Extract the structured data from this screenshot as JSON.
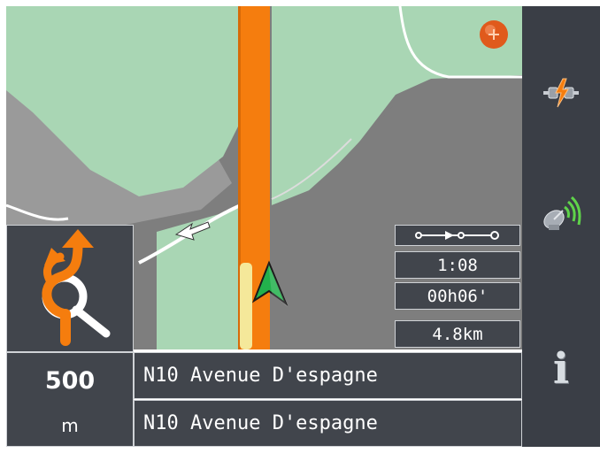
{
  "map": {
    "colors": {
      "land_green": "#a9d6b4",
      "land_gray": "#9b9b9b",
      "background": "#7e7e7e",
      "route": "#f57d0e",
      "position_arrow": "#22b14c"
    }
  },
  "route_info": {
    "legend_icon": "route-progress-icon",
    "arrival_time": "1:08",
    "remaining_time": "00h06'",
    "remaining_distance": "4.8km"
  },
  "next_turn": {
    "icon": "roundabout-turn-icon",
    "distance_value": "500",
    "distance_unit": "m"
  },
  "streets": {
    "current": "N10 Avenue D'espagne",
    "next": "N10 Avenue D'espagne"
  },
  "sidebar": {
    "items": [
      {
        "icon": "gps-connection-icon"
      },
      {
        "icon": "satellite-signal-icon"
      },
      {
        "icon": "info-icon",
        "label": "i"
      }
    ]
  },
  "compass": {
    "icon": "compass-icon"
  }
}
